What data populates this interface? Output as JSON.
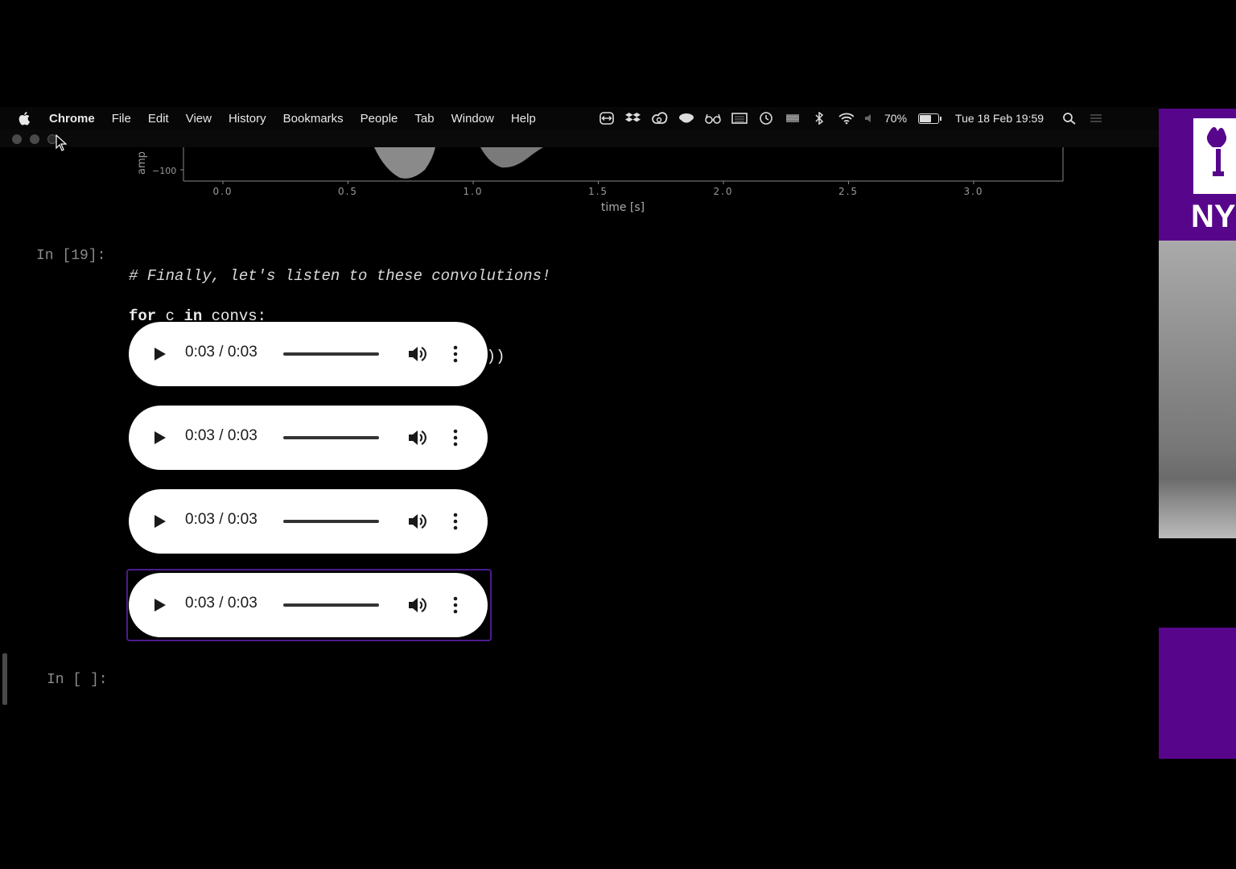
{
  "menubar": {
    "app": "Chrome",
    "items": [
      "File",
      "Edit",
      "View",
      "History",
      "Bookmarks",
      "People",
      "Tab",
      "Window",
      "Help"
    ],
    "battery_text": "70%",
    "battery_level": 0.7,
    "datetime": "Tue 18 Feb  19:59"
  },
  "plot": {
    "ylabel": "amp",
    "ytick": "−100",
    "xticks": [
      "0.0",
      "0.5",
      "1.0",
      "1.5",
      "2.0",
      "2.5",
      "3.0"
    ],
    "xlabel": "time [s]"
  },
  "cells": [
    {
      "prompt": "In [19]:",
      "code": {
        "line1": "# Finally, let's listen to these convolutions!",
        "line2_kw": "for",
        "line2_mid": " c ",
        "line2_kw2": "in",
        "line2_end": " convs:",
        "line3": "    display(Audio(c, rate=sampling_rate))"
      },
      "outputs": [
        {
          "time": "0:03 / 0:03",
          "progress": 1.0
        },
        {
          "time": "0:03 / 0:03",
          "progress": 1.0
        },
        {
          "time": "0:03 / 0:03",
          "progress": 1.0
        },
        {
          "time": "0:03 / 0:03",
          "progress": 1.0
        }
      ]
    },
    {
      "prompt": "In [ ]:"
    }
  ],
  "side": {
    "brand_text": "NY"
  }
}
